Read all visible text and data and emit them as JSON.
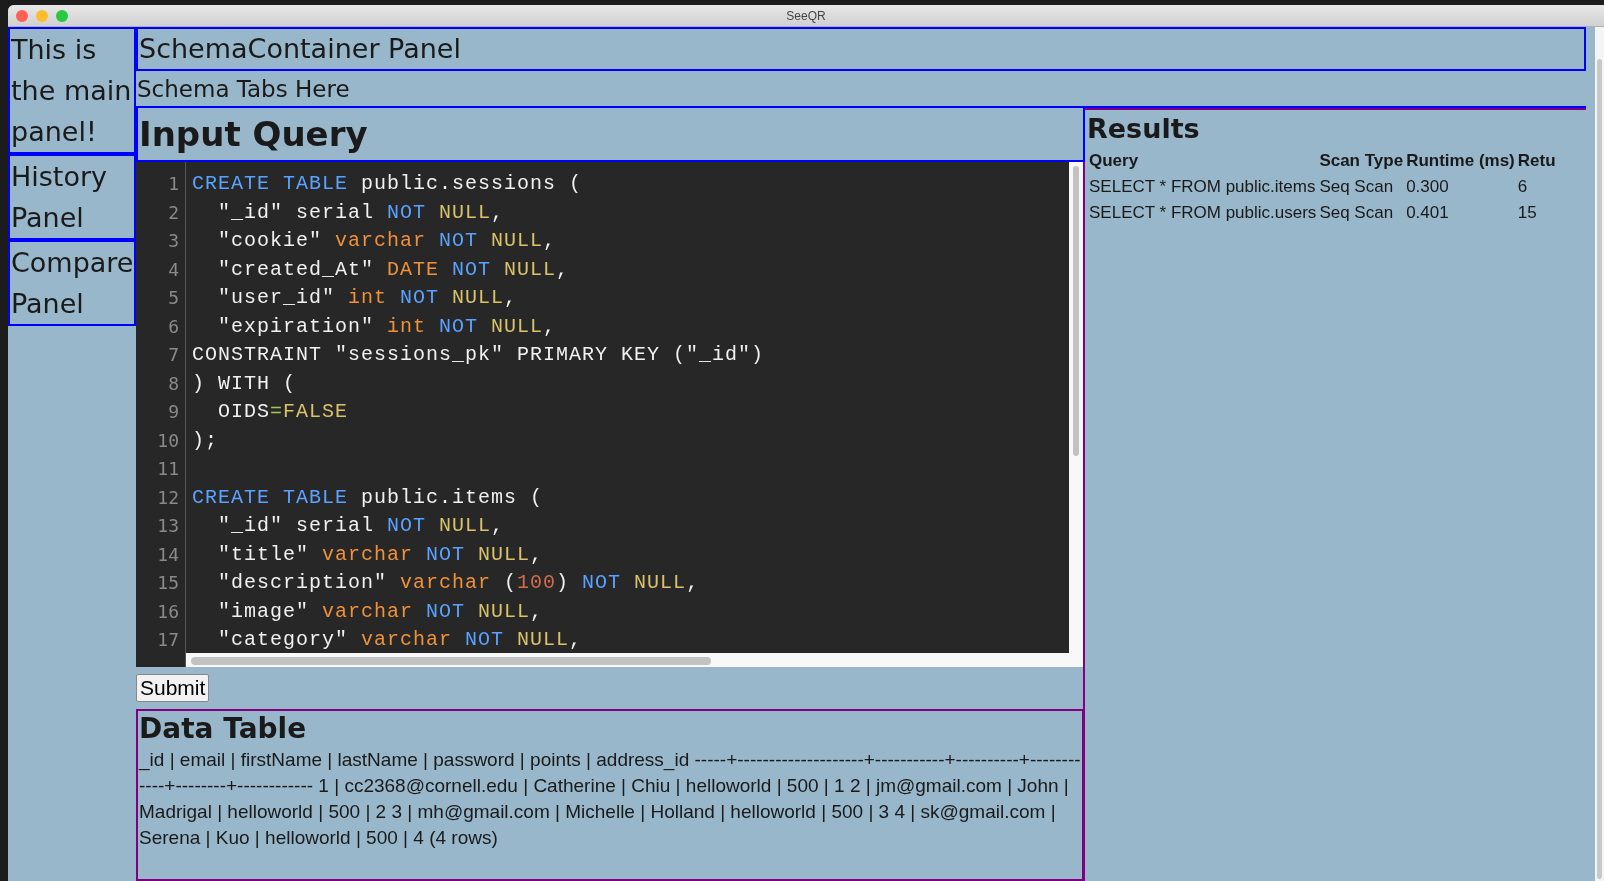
{
  "window": {
    "title": "SeeQR"
  },
  "sidebar": {
    "panels": [
      {
        "label": "This is the main panel!"
      },
      {
        "label": "History Panel"
      },
      {
        "label": "Compare Panel"
      }
    ]
  },
  "schema_container": {
    "title": "SchemaContainer Panel",
    "tabs_label": "Schema Tabs Here"
  },
  "input_query": {
    "title": "Input Query",
    "code_lines": [
      {
        "number": "1",
        "tokens": [
          {
            "text": "CREATE ",
            "kind": "keyword"
          },
          {
            "text": "TABLE ",
            "kind": "keyword"
          },
          {
            "text": "public.sessions ("
          }
        ]
      },
      {
        "number": "2",
        "tokens": [
          {
            "text": "  \"_id\" serial "
          },
          {
            "text": "NOT ",
            "kind": "keyword"
          },
          {
            "text": "NULL",
            "kind": "atom"
          },
          {
            "text": ","
          }
        ]
      },
      {
        "number": "3",
        "tokens": [
          {
            "text": "  \"cookie\" "
          },
          {
            "text": "varchar ",
            "kind": "type"
          },
          {
            "text": "NOT ",
            "kind": "keyword"
          },
          {
            "text": "NULL",
            "kind": "atom"
          },
          {
            "text": ","
          }
        ]
      },
      {
        "number": "4",
        "tokens": [
          {
            "text": "  \"created_At\" "
          },
          {
            "text": "DATE ",
            "kind": "type"
          },
          {
            "text": "NOT ",
            "kind": "keyword"
          },
          {
            "text": "NULL",
            "kind": "atom"
          },
          {
            "text": ","
          }
        ]
      },
      {
        "number": "5",
        "tokens": [
          {
            "text": "  \"user_id\" "
          },
          {
            "text": "int ",
            "kind": "type"
          },
          {
            "text": "NOT ",
            "kind": "keyword"
          },
          {
            "text": "NULL",
            "kind": "atom"
          },
          {
            "text": ","
          }
        ]
      },
      {
        "number": "6",
        "tokens": [
          {
            "text": "  \"expiration\" "
          },
          {
            "text": "int ",
            "kind": "type"
          },
          {
            "text": "NOT ",
            "kind": "keyword"
          },
          {
            "text": "NULL",
            "kind": "atom"
          },
          {
            "text": ","
          }
        ]
      },
      {
        "number": "7",
        "tokens": [
          {
            "text": "CONSTRAINT \"sessions_pk\" PRIMARY KEY (\"_id\")"
          }
        ]
      },
      {
        "number": "8",
        "tokens": [
          {
            "text": ") WITH ("
          }
        ]
      },
      {
        "number": "9",
        "tokens": [
          {
            "text": "  OIDS"
          },
          {
            "text": "=",
            "kind": "operator"
          },
          {
            "text": "FALSE",
            "kind": "atom"
          }
        ]
      },
      {
        "number": "10",
        "tokens": [
          {
            "text": ");"
          }
        ]
      },
      {
        "number": "11"
      },
      {
        "number": "12",
        "tokens": [
          {
            "text": "CREATE ",
            "kind": "keyword"
          },
          {
            "text": "TABLE ",
            "kind": "keyword"
          },
          {
            "text": "public.items ("
          }
        ]
      },
      {
        "number": "13",
        "tokens": [
          {
            "text": "  \"_id\" serial "
          },
          {
            "text": "NOT ",
            "kind": "keyword"
          },
          {
            "text": "NULL",
            "kind": "atom"
          },
          {
            "text": ","
          }
        ]
      },
      {
        "number": "14",
        "tokens": [
          {
            "text": "  \"title\" "
          },
          {
            "text": "varchar ",
            "kind": "type"
          },
          {
            "text": "NOT ",
            "kind": "keyword"
          },
          {
            "text": "NULL",
            "kind": "atom"
          },
          {
            "text": ","
          }
        ]
      },
      {
        "number": "15",
        "tokens": [
          {
            "text": "  \"description\" "
          },
          {
            "text": "varchar ",
            "kind": "type"
          },
          {
            "text": "("
          },
          {
            "text": "100",
            "kind": "number"
          },
          {
            "text": ") "
          },
          {
            "text": "NOT ",
            "kind": "keyword"
          },
          {
            "text": "NULL",
            "kind": "atom"
          },
          {
            "text": ","
          }
        ]
      },
      {
        "number": "16",
        "tokens": [
          {
            "text": "  \"image\" "
          },
          {
            "text": "varchar ",
            "kind": "type"
          },
          {
            "text": "NOT ",
            "kind": "keyword"
          },
          {
            "text": "NULL",
            "kind": "atom"
          },
          {
            "text": ","
          }
        ]
      },
      {
        "number": "17",
        "tokens": [
          {
            "text": "  \"category\" "
          },
          {
            "text": "varchar ",
            "kind": "type"
          },
          {
            "text": "NOT ",
            "kind": "keyword"
          },
          {
            "text": "NULL",
            "kind": "atom"
          },
          {
            "text": ","
          }
        ]
      }
    ],
    "submit": "Submit"
  },
  "data_table": {
    "title": "Data Table",
    "text": "_id | email | firstName | lastName | password | points | address_id -----+--------------------+-----------+----------+------------+--------+------------ 1 | cc2368@cornell.edu | Catherine | Chiu | helloworld | 500 | 1 2 | jm@gmail.com | John | Madrigal | helloworld | 500 | 2 3 | mh@gmail.com | Michelle | Holland | helloworld | 500 | 3 4 | sk@gmail.com | Serena | Kuo | helloworld | 500 | 4 (4 rows)"
  },
  "results": {
    "title": "Results",
    "columns": [
      "Query",
      "Scan Type",
      "Runtime (ms)",
      "Retu"
    ],
    "rows": [
      [
        "SELECT * FROM public.items",
        "Seq Scan",
        "0.300",
        "6"
      ],
      [
        "SELECT * FROM public.users",
        "Seq Scan",
        "0.401",
        "15"
      ]
    ]
  }
}
